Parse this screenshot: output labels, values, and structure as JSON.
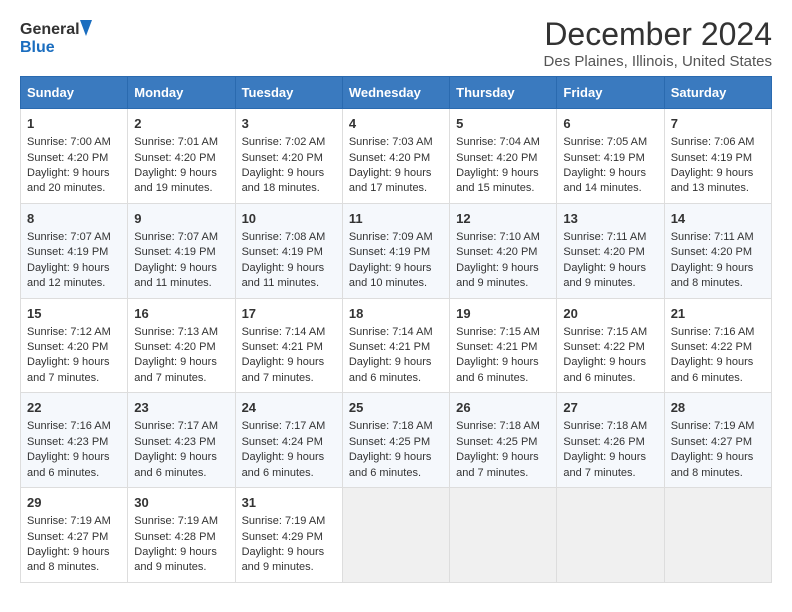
{
  "logo": {
    "line1": "General",
    "line2": "Blue"
  },
  "title": "December 2024",
  "subtitle": "Des Plaines, Illinois, United States",
  "days_of_week": [
    "Sunday",
    "Monday",
    "Tuesday",
    "Wednesday",
    "Thursday",
    "Friday",
    "Saturday"
  ],
  "weeks": [
    [
      {
        "day": 1,
        "sunrise": "7:00 AM",
        "sunset": "4:20 PM",
        "daylight": "9 hours and 20 minutes."
      },
      {
        "day": 2,
        "sunrise": "7:01 AM",
        "sunset": "4:20 PM",
        "daylight": "9 hours and 19 minutes."
      },
      {
        "day": 3,
        "sunrise": "7:02 AM",
        "sunset": "4:20 PM",
        "daylight": "9 hours and 18 minutes."
      },
      {
        "day": 4,
        "sunrise": "7:03 AM",
        "sunset": "4:20 PM",
        "daylight": "9 hours and 17 minutes."
      },
      {
        "day": 5,
        "sunrise": "7:04 AM",
        "sunset": "4:20 PM",
        "daylight": "9 hours and 15 minutes."
      },
      {
        "day": 6,
        "sunrise": "7:05 AM",
        "sunset": "4:19 PM",
        "daylight": "9 hours and 14 minutes."
      },
      {
        "day": 7,
        "sunrise": "7:06 AM",
        "sunset": "4:19 PM",
        "daylight": "9 hours and 13 minutes."
      }
    ],
    [
      {
        "day": 8,
        "sunrise": "7:07 AM",
        "sunset": "4:19 PM",
        "daylight": "9 hours and 12 minutes."
      },
      {
        "day": 9,
        "sunrise": "7:07 AM",
        "sunset": "4:19 PM",
        "daylight": "9 hours and 11 minutes."
      },
      {
        "day": 10,
        "sunrise": "7:08 AM",
        "sunset": "4:19 PM",
        "daylight": "9 hours and 11 minutes."
      },
      {
        "day": 11,
        "sunrise": "7:09 AM",
        "sunset": "4:19 PM",
        "daylight": "9 hours and 10 minutes."
      },
      {
        "day": 12,
        "sunrise": "7:10 AM",
        "sunset": "4:20 PM",
        "daylight": "9 hours and 9 minutes."
      },
      {
        "day": 13,
        "sunrise": "7:11 AM",
        "sunset": "4:20 PM",
        "daylight": "9 hours and 9 minutes."
      },
      {
        "day": 14,
        "sunrise": "7:11 AM",
        "sunset": "4:20 PM",
        "daylight": "9 hours and 8 minutes."
      }
    ],
    [
      {
        "day": 15,
        "sunrise": "7:12 AM",
        "sunset": "4:20 PM",
        "daylight": "9 hours and 7 minutes."
      },
      {
        "day": 16,
        "sunrise": "7:13 AM",
        "sunset": "4:20 PM",
        "daylight": "9 hours and 7 minutes."
      },
      {
        "day": 17,
        "sunrise": "7:14 AM",
        "sunset": "4:21 PM",
        "daylight": "9 hours and 7 minutes."
      },
      {
        "day": 18,
        "sunrise": "7:14 AM",
        "sunset": "4:21 PM",
        "daylight": "9 hours and 6 minutes."
      },
      {
        "day": 19,
        "sunrise": "7:15 AM",
        "sunset": "4:21 PM",
        "daylight": "9 hours and 6 minutes."
      },
      {
        "day": 20,
        "sunrise": "7:15 AM",
        "sunset": "4:22 PM",
        "daylight": "9 hours and 6 minutes."
      },
      {
        "day": 21,
        "sunrise": "7:16 AM",
        "sunset": "4:22 PM",
        "daylight": "9 hours and 6 minutes."
      }
    ],
    [
      {
        "day": 22,
        "sunrise": "7:16 AM",
        "sunset": "4:23 PM",
        "daylight": "9 hours and 6 minutes."
      },
      {
        "day": 23,
        "sunrise": "7:17 AM",
        "sunset": "4:23 PM",
        "daylight": "9 hours and 6 minutes."
      },
      {
        "day": 24,
        "sunrise": "7:17 AM",
        "sunset": "4:24 PM",
        "daylight": "9 hours and 6 minutes."
      },
      {
        "day": 25,
        "sunrise": "7:18 AM",
        "sunset": "4:25 PM",
        "daylight": "9 hours and 6 minutes."
      },
      {
        "day": 26,
        "sunrise": "7:18 AM",
        "sunset": "4:25 PM",
        "daylight": "9 hours and 7 minutes."
      },
      {
        "day": 27,
        "sunrise": "7:18 AM",
        "sunset": "4:26 PM",
        "daylight": "9 hours and 7 minutes."
      },
      {
        "day": 28,
        "sunrise": "7:19 AM",
        "sunset": "4:27 PM",
        "daylight": "9 hours and 8 minutes."
      }
    ],
    [
      {
        "day": 29,
        "sunrise": "7:19 AM",
        "sunset": "4:27 PM",
        "daylight": "9 hours and 8 minutes."
      },
      {
        "day": 30,
        "sunrise": "7:19 AM",
        "sunset": "4:28 PM",
        "daylight": "9 hours and 9 minutes."
      },
      {
        "day": 31,
        "sunrise": "7:19 AM",
        "sunset": "4:29 PM",
        "daylight": "9 hours and 9 minutes."
      },
      null,
      null,
      null,
      null
    ]
  ],
  "labels": {
    "sunrise": "Sunrise:",
    "sunset": "Sunset:",
    "daylight": "Daylight:"
  }
}
